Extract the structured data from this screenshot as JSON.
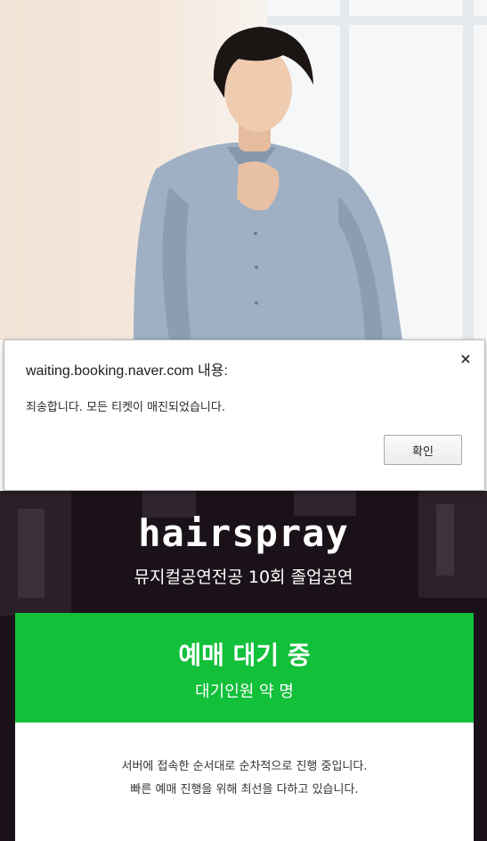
{
  "dialog": {
    "title": "waiting.booking.naver.com 내용:",
    "message": "죄송합니다. 모든 티켓이 매진되었습니다.",
    "ok_label": "확인",
    "close_glyph": "×"
  },
  "show": {
    "logo_text": "hairspray",
    "subtitle": "뮤지컬공연전공 10회 졸업공연"
  },
  "waiting": {
    "title": "예매 대기 중",
    "count_text": "대기인원 약 명",
    "accent_color": "#12c03a"
  },
  "info": {
    "line1": "서버에 접속한 순서대로 순차적으로 진행 중입니다.",
    "line2": "빠른 예매 진행을 위해 최선을 다하고 있습니다."
  }
}
